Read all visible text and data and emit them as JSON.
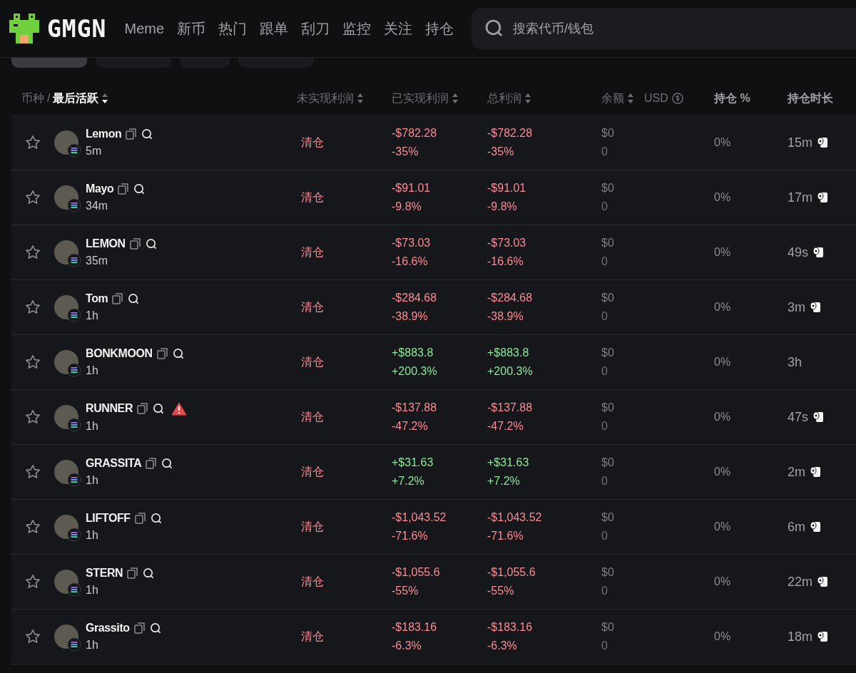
{
  "header": {
    "logo": "GMGN",
    "nav": [
      {
        "label": "Meme",
        "selected": false
      },
      {
        "label": "新币",
        "selected": false
      },
      {
        "label": "热门",
        "selected": false
      },
      {
        "label": "跟单",
        "selected": false
      },
      {
        "label": "刮刀",
        "selected": false
      },
      {
        "label": "监控",
        "selected": false
      },
      {
        "label": "关注",
        "selected": false
      },
      {
        "label": "持仓",
        "selected": false
      }
    ],
    "search": {
      "placeholder": "搜索代币/钱包"
    }
  },
  "filter_tabs": [
    {
      "selected": true
    },
    {
      "selected": false
    },
    {
      "selected": false
    },
    {
      "selected": false
    }
  ],
  "columns": {
    "token": "币种",
    "separator": "/",
    "last_active": "最后活跃",
    "unrealized": "未实现利润",
    "realized": "已实现利润",
    "total": "总利润",
    "balance": "余额",
    "currency": "USD",
    "holding_pct": "持仓 %",
    "holding_time": "持仓时长"
  },
  "rows": [
    {
      "name": "Lemon",
      "age": "5m",
      "warning": false,
      "status": "清仓",
      "profit": false,
      "realized": "-$782.28",
      "realized_pct": "-35%",
      "total": "-$782.28",
      "total_pct": "-35%",
      "balance": "$0",
      "amount": "0",
      "pct": "0%",
      "duration": "15m",
      "sold_all": true
    },
    {
      "name": "Mayo",
      "age": "34m",
      "warning": false,
      "status": "清仓",
      "profit": false,
      "realized": "-$91.01",
      "realized_pct": "-9.8%",
      "total": "-$91.01",
      "total_pct": "-9.8%",
      "balance": "$0",
      "amount": "0",
      "pct": "0%",
      "duration": "17m",
      "sold_all": true
    },
    {
      "name": "LEMON",
      "age": "35m",
      "warning": false,
      "status": "清仓",
      "profit": false,
      "realized": "-$73.03",
      "realized_pct": "-16.6%",
      "total": "-$73.03",
      "total_pct": "-16.6%",
      "balance": "$0",
      "amount": "0",
      "pct": "0%",
      "duration": "49s",
      "sold_all": true
    },
    {
      "name": "Tom",
      "age": "1h",
      "warning": false,
      "status": "清仓",
      "profit": false,
      "realized": "-$284.68",
      "realized_pct": "-38.9%",
      "total": "-$284.68",
      "total_pct": "-38.9%",
      "balance": "$0",
      "amount": "0",
      "pct": "0%",
      "duration": "3m",
      "sold_all": true
    },
    {
      "name": "BONKMOON",
      "age": "1h",
      "warning": false,
      "status": "清仓",
      "profit": true,
      "realized": "+$883.8",
      "realized_pct": "+200.3%",
      "total": "+$883.8",
      "total_pct": "+200.3%",
      "balance": "$0",
      "amount": "0",
      "pct": "0%",
      "duration": "3h",
      "sold_all": false
    },
    {
      "name": "RUNNER",
      "age": "1h",
      "warning": true,
      "status": "清仓",
      "profit": false,
      "realized": "-$137.88",
      "realized_pct": "-47.2%",
      "total": "-$137.88",
      "total_pct": "-47.2%",
      "balance": "$0",
      "amount": "0",
      "pct": "0%",
      "duration": "47s",
      "sold_all": true
    },
    {
      "name": "GRASSITA",
      "age": "1h",
      "warning": false,
      "status": "清仓",
      "profit": true,
      "realized": "+$31.63",
      "realized_pct": "+7.2%",
      "total": "+$31.63",
      "total_pct": "+7.2%",
      "balance": "$0",
      "amount": "0",
      "pct": "0%",
      "duration": "2m",
      "sold_all": true
    },
    {
      "name": "LIFTOFF",
      "age": "1h",
      "warning": false,
      "status": "清仓",
      "profit": false,
      "realized": "-$1,043.52",
      "realized_pct": "-71.6%",
      "total": "-$1,043.52",
      "total_pct": "-71.6%",
      "balance": "$0",
      "amount": "0",
      "pct": "0%",
      "duration": "6m",
      "sold_all": true
    },
    {
      "name": "STERN",
      "age": "1h",
      "warning": false,
      "status": "清仓",
      "profit": false,
      "realized": "-$1,055.6",
      "realized_pct": "-55%",
      "total": "-$1,055.6",
      "total_pct": "-55%",
      "balance": "$0",
      "amount": "0",
      "pct": "0%",
      "duration": "22m",
      "sold_all": true
    },
    {
      "name": "Grassito",
      "age": "1h",
      "warning": false,
      "status": "清仓",
      "profit": false,
      "realized": "-$183.16",
      "realized_pct": "-6.3%",
      "total": "-$183.16",
      "total_pct": "-6.3%",
      "balance": "$0",
      "amount": "0",
      "pct": "0%",
      "duration": "18m",
      "sold_all": true
    }
  ]
}
